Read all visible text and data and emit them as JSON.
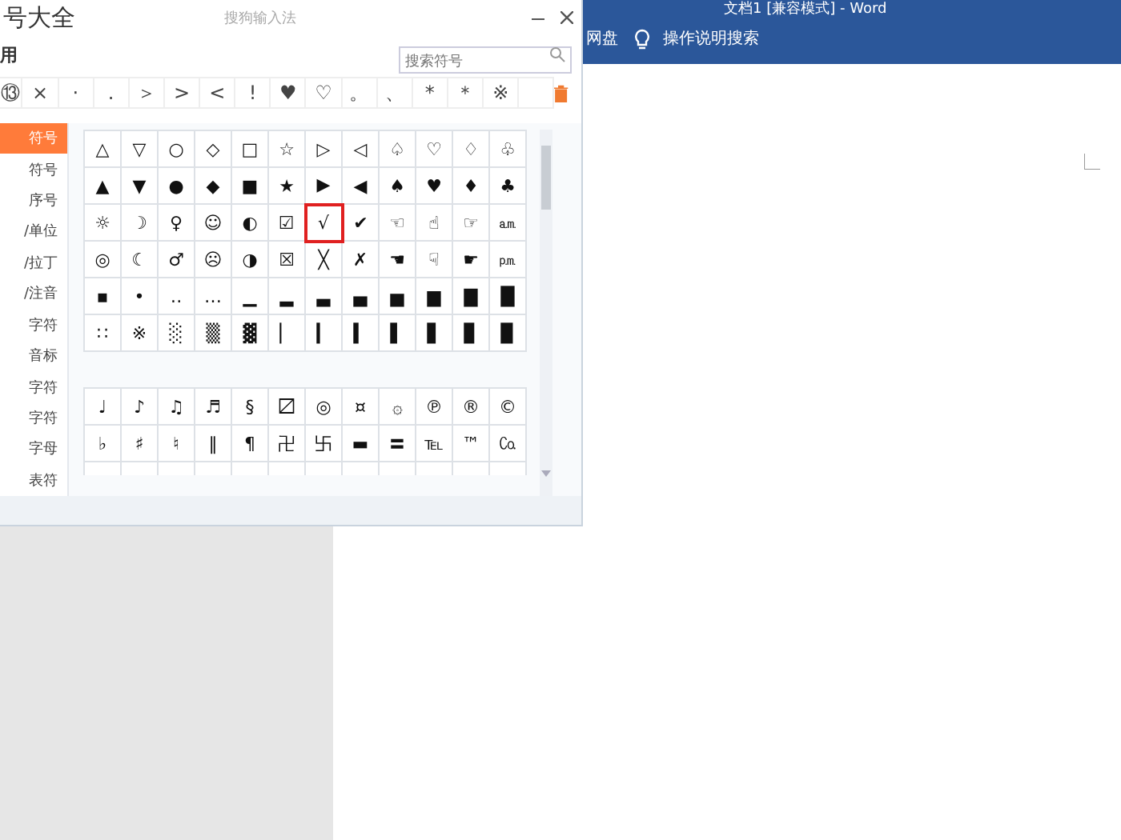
{
  "word": {
    "title": "文档1 [兼容模式] - Word",
    "toolbar": [
      {
        "kind": "text",
        "label": "网盘"
      },
      {
        "kind": "search",
        "label": "操作说明搜索"
      }
    ]
  },
  "dialog": {
    "title": "号大全",
    "brand": "搜狗输入法",
    "tab": "用",
    "search": {
      "placeholder": "搜索符号"
    },
    "recent": [
      "⑬",
      "×",
      "·",
      ".",
      "＞",
      ">",
      "<",
      "!",
      "♥",
      "♡",
      "。",
      "、",
      "*",
      "＊",
      "※"
    ],
    "categories": [
      {
        "label": "符号",
        "selected": true
      },
      {
        "label": "符号",
        "selected": false
      },
      {
        "label": "序号",
        "selected": false
      },
      {
        "label": "/单位",
        "selected": false
      },
      {
        "label": "/拉丁",
        "selected": false
      },
      {
        "label": "/注音",
        "selected": false
      },
      {
        "label": "字符",
        "selected": false
      },
      {
        "label": "音标",
        "selected": false
      },
      {
        "label": "字符",
        "selected": false
      },
      {
        "label": "字符",
        "selected": false
      },
      {
        "label": "字母",
        "selected": false
      },
      {
        "label": "表符",
        "selected": false
      }
    ],
    "grids": [
      {
        "rows": [
          [
            {
              "symbol": "△",
              "selected": false
            },
            {
              "symbol": "▽",
              "selected": false
            },
            {
              "symbol": "○",
              "selected": false
            },
            {
              "symbol": "◇",
              "selected": false
            },
            {
              "symbol": "□",
              "selected": false
            },
            {
              "symbol": "☆",
              "selected": false
            },
            {
              "symbol": "▷",
              "selected": false
            },
            {
              "symbol": "◁",
              "selected": false
            },
            {
              "symbol": "♤",
              "selected": false
            },
            {
              "symbol": "♡",
              "selected": false
            },
            {
              "symbol": "♢",
              "selected": false
            },
            {
              "symbol": "♧",
              "selected": false
            }
          ],
          [
            {
              "symbol": "▲",
              "selected": false
            },
            {
              "symbol": "▼",
              "selected": false
            },
            {
              "symbol": "●",
              "selected": false
            },
            {
              "symbol": "◆",
              "selected": false
            },
            {
              "symbol": "■",
              "selected": false
            },
            {
              "symbol": "★",
              "selected": false
            },
            {
              "symbol": "▶",
              "selected": false
            },
            {
              "symbol": "◀",
              "selected": false
            },
            {
              "symbol": "♠",
              "selected": false
            },
            {
              "symbol": "♥",
              "selected": false
            },
            {
              "symbol": "♦",
              "selected": false
            },
            {
              "symbol": "♣",
              "selected": false
            }
          ],
          [
            {
              "symbol": "☼",
              "selected": false
            },
            {
              "symbol": "☽",
              "selected": false
            },
            {
              "symbol": "♀",
              "selected": false
            },
            {
              "symbol": "☺",
              "selected": false
            },
            {
              "symbol": "◐",
              "selected": false
            },
            {
              "symbol": "☑",
              "selected": false
            },
            {
              "symbol": "√",
              "selected": true
            },
            {
              "symbol": "✔",
              "selected": false
            },
            {
              "symbol": "☜",
              "selected": false
            },
            {
              "symbol": "☝",
              "selected": false
            },
            {
              "symbol": "☞",
              "selected": false
            },
            {
              "symbol": "㏂",
              "selected": false
            }
          ],
          [
            {
              "symbol": "◎",
              "selected": false
            },
            {
              "symbol": "☾",
              "selected": false
            },
            {
              "symbol": "♂",
              "selected": false
            },
            {
              "symbol": "☹",
              "selected": false
            },
            {
              "symbol": "◑",
              "selected": false
            },
            {
              "symbol": "☒",
              "selected": false
            },
            {
              "symbol": "╳",
              "selected": false
            },
            {
              "symbol": "✗",
              "selected": false
            },
            {
              "symbol": "☚",
              "selected": false
            },
            {
              "symbol": "☟",
              "selected": false
            },
            {
              "symbol": "☛",
              "selected": false
            },
            {
              "symbol": "㏘",
              "selected": false
            }
          ],
          [
            {
              "symbol": "▪",
              "selected": false
            },
            {
              "symbol": "•",
              "selected": false
            },
            {
              "symbol": "‥",
              "selected": false
            },
            {
              "symbol": "…",
              "selected": false
            },
            {
              "symbol": "▁",
              "selected": false
            },
            {
              "symbol": "▂",
              "selected": false
            },
            {
              "symbol": "▃",
              "selected": false
            },
            {
              "symbol": "▄",
              "selected": false
            },
            {
              "symbol": "▅",
              "selected": false
            },
            {
              "symbol": "▆",
              "selected": false
            },
            {
              "symbol": "▇",
              "selected": false
            },
            {
              "symbol": "█",
              "selected": false
            }
          ],
          [
            {
              "symbol": "∷",
              "selected": false
            },
            {
              "symbol": "※",
              "selected": false
            },
            {
              "symbol": "░",
              "selected": false
            },
            {
              "symbol": "▒",
              "selected": false
            },
            {
              "symbol": "▓",
              "selected": false
            },
            {
              "symbol": "▏",
              "selected": false
            },
            {
              "symbol": "▎",
              "selected": false
            },
            {
              "symbol": "▍",
              "selected": false
            },
            {
              "symbol": "▌",
              "selected": false
            },
            {
              "symbol": "▋",
              "selected": false
            },
            {
              "symbol": "▊",
              "selected": false
            },
            {
              "symbol": "▉",
              "selected": false
            }
          ]
        ]
      },
      {
        "rows": [
          [
            {
              "symbol": "♩",
              "selected": false
            },
            {
              "symbol": "♪",
              "selected": false
            },
            {
              "symbol": "♫",
              "selected": false
            },
            {
              "symbol": "♬",
              "selected": false
            },
            {
              "symbol": "§",
              "selected": false
            },
            {
              "symbol": "〼",
              "selected": false
            },
            {
              "symbol": "◎",
              "selected": false
            },
            {
              "symbol": "¤",
              "selected": false
            },
            {
              "symbol": "۞",
              "selected": false
            },
            {
              "symbol": "℗",
              "selected": false
            },
            {
              "symbol": "®",
              "selected": false
            },
            {
              "symbol": "©",
              "selected": false
            }
          ],
          [
            {
              "symbol": "♭",
              "selected": false
            },
            {
              "symbol": "♯",
              "selected": false
            },
            {
              "symbol": "♮",
              "selected": false
            },
            {
              "symbol": "‖",
              "selected": false
            },
            {
              "symbol": "¶",
              "selected": false
            },
            {
              "symbol": "卍",
              "selected": false
            },
            {
              "symbol": "卐",
              "selected": false
            },
            {
              "symbol": "▬",
              "selected": false
            },
            {
              "symbol": "〓",
              "selected": false
            },
            {
              "symbol": "℡",
              "selected": false
            },
            {
              "symbol": "™",
              "selected": false
            },
            {
              "symbol": "㏇",
              "selected": false
            }
          ]
        ]
      }
    ]
  }
}
